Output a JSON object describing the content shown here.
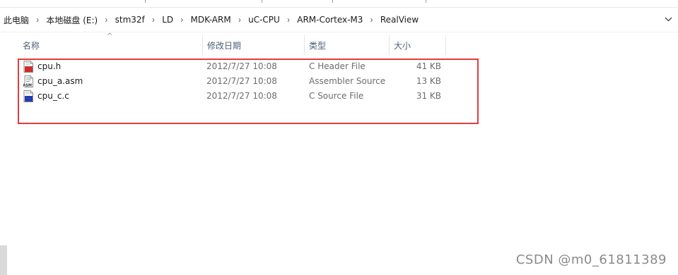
{
  "breadcrumb": {
    "items": [
      "此电脑",
      "本地磁盘 (E:)",
      "stm32f",
      "LD",
      "MDK-ARM",
      "uC-CPU",
      "ARM-Cortex-M3",
      "RealView"
    ],
    "separator": "›"
  },
  "columns": {
    "name": "名称",
    "date": "修改日期",
    "type": "类型",
    "size": "大小",
    "sort_indicator": "^"
  },
  "files": [
    {
      "name": "cpu.h",
      "date": "2012/7/27 10:08",
      "type": "C Header File",
      "size": "41 KB",
      "icon": "c-header-file-icon"
    },
    {
      "name": "cpu_a.asm",
      "date": "2012/7/27 10:08",
      "type": "Assembler Source",
      "size": "13 KB",
      "icon": "asm-file-icon"
    },
    {
      "name": "cpu_c.c",
      "date": "2012/7/27 10:08",
      "type": "C Source File",
      "size": "31 KB",
      "icon": "c-source-file-icon"
    }
  ],
  "annotation": {
    "highlight_color": "#e23b3b"
  },
  "watermark": "CSDN @m0_61811389",
  "colors": {
    "header_text": "#4c607a",
    "meta_text": "#6d6d6d"
  }
}
